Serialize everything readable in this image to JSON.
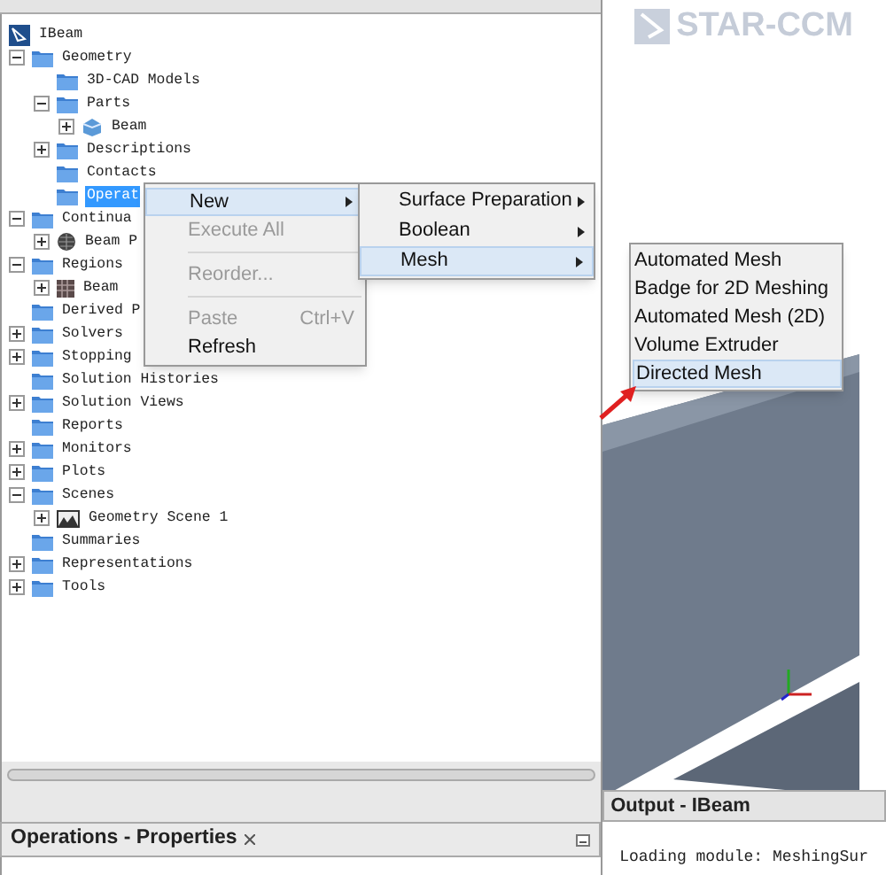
{
  "tree": [
    {
      "label": "IBeam",
      "kind": "root",
      "selected": false,
      "children": [
        {
          "label": "Geometry",
          "kind": "folder",
          "expanded": true,
          "selected": false,
          "children": [
            {
              "label": "3D-CAD Models",
              "kind": "folder",
              "selected": false
            },
            {
              "label": "Parts",
              "kind": "folder",
              "expanded": true,
              "selected": false,
              "children": [
                {
                  "label": "Beam",
                  "kind": "part",
                  "expanded": false,
                  "selected": false
                }
              ]
            },
            {
              "label": "Descriptions",
              "kind": "folder",
              "expanded": false,
              "selected": false
            },
            {
              "label": "Contacts",
              "kind": "folder",
              "selected": false
            },
            {
              "label": "Operat",
              "kind": "folder",
              "selected": true
            }
          ]
        },
        {
          "label": "Continua",
          "kind": "folder",
          "expanded": true,
          "selected": false,
          "children": [
            {
              "label": "Beam P",
              "kind": "continuum",
              "expanded": false,
              "selected": false
            }
          ]
        },
        {
          "label": "Regions",
          "kind": "folder",
          "expanded": true,
          "selected": false,
          "children": [
            {
              "label": "Beam",
              "kind": "region",
              "expanded": false,
              "selected": false
            }
          ]
        },
        {
          "label": "Derived P",
          "kind": "folder",
          "selected": false
        },
        {
          "label": "Solvers",
          "kind": "folder",
          "expanded": false,
          "selected": false
        },
        {
          "label": "Stopping",
          "kind": "folder",
          "expanded": false,
          "selected": false
        },
        {
          "label": "Solution Histories",
          "kind": "folder",
          "selected": false
        },
        {
          "label": "Solution Views",
          "kind": "folder",
          "expanded": false,
          "selected": false
        },
        {
          "label": "Reports",
          "kind": "folder",
          "selected": false
        },
        {
          "label": "Monitors",
          "kind": "folder",
          "expanded": false,
          "selected": false
        },
        {
          "label": "Plots",
          "kind": "folder",
          "expanded": false,
          "selected": false
        },
        {
          "label": "Scenes",
          "kind": "folder",
          "expanded": true,
          "selected": false,
          "children": [
            {
              "label": "Geometry Scene 1",
              "kind": "scene",
              "expanded": false,
              "selected": false
            }
          ]
        },
        {
          "label": "Summaries",
          "kind": "folder",
          "selected": false
        },
        {
          "label": "Representations",
          "kind": "folder",
          "expanded": false,
          "selected": false
        },
        {
          "label": "Tools",
          "kind": "folder",
          "expanded": false,
          "selected": false
        }
      ]
    }
  ],
  "context_menu": [
    {
      "label": "New",
      "submenu": true,
      "disabled": false,
      "selected": true
    },
    {
      "label": "Execute All",
      "submenu": false,
      "disabled": true,
      "selected": false
    },
    {
      "label": "Reorder...",
      "submenu": false,
      "disabled": true,
      "selected": false,
      "separator_before": true
    },
    {
      "label": "Paste",
      "shortcut": "Ctrl+V",
      "submenu": false,
      "disabled": true,
      "selected": false,
      "separator_before": true
    },
    {
      "label": "Refresh",
      "submenu": false,
      "disabled": false,
      "selected": false
    }
  ],
  "new_submenu": [
    {
      "label": "Surface Preparation",
      "submenu": true,
      "selected": false
    },
    {
      "label": "Boolean",
      "submenu": true,
      "selected": false
    },
    {
      "label": "Mesh",
      "submenu": true,
      "selected": true
    }
  ],
  "mesh_submenu": [
    {
      "label": "Automated Mesh",
      "selected": false
    },
    {
      "label": "Badge for 2D Meshing",
      "selected": false
    },
    {
      "label": "Automated Mesh (2D)",
      "selected": false
    },
    {
      "label": "Volume Extruder",
      "selected": false
    },
    {
      "label": "Directed Mesh",
      "selected": true
    }
  ],
  "logo": "STAR-CCM",
  "properties_panel": {
    "title": "Operations - Properties"
  },
  "output_panel": {
    "title": "Output - IBeam",
    "line": "Loading module: MeshingSur"
  }
}
